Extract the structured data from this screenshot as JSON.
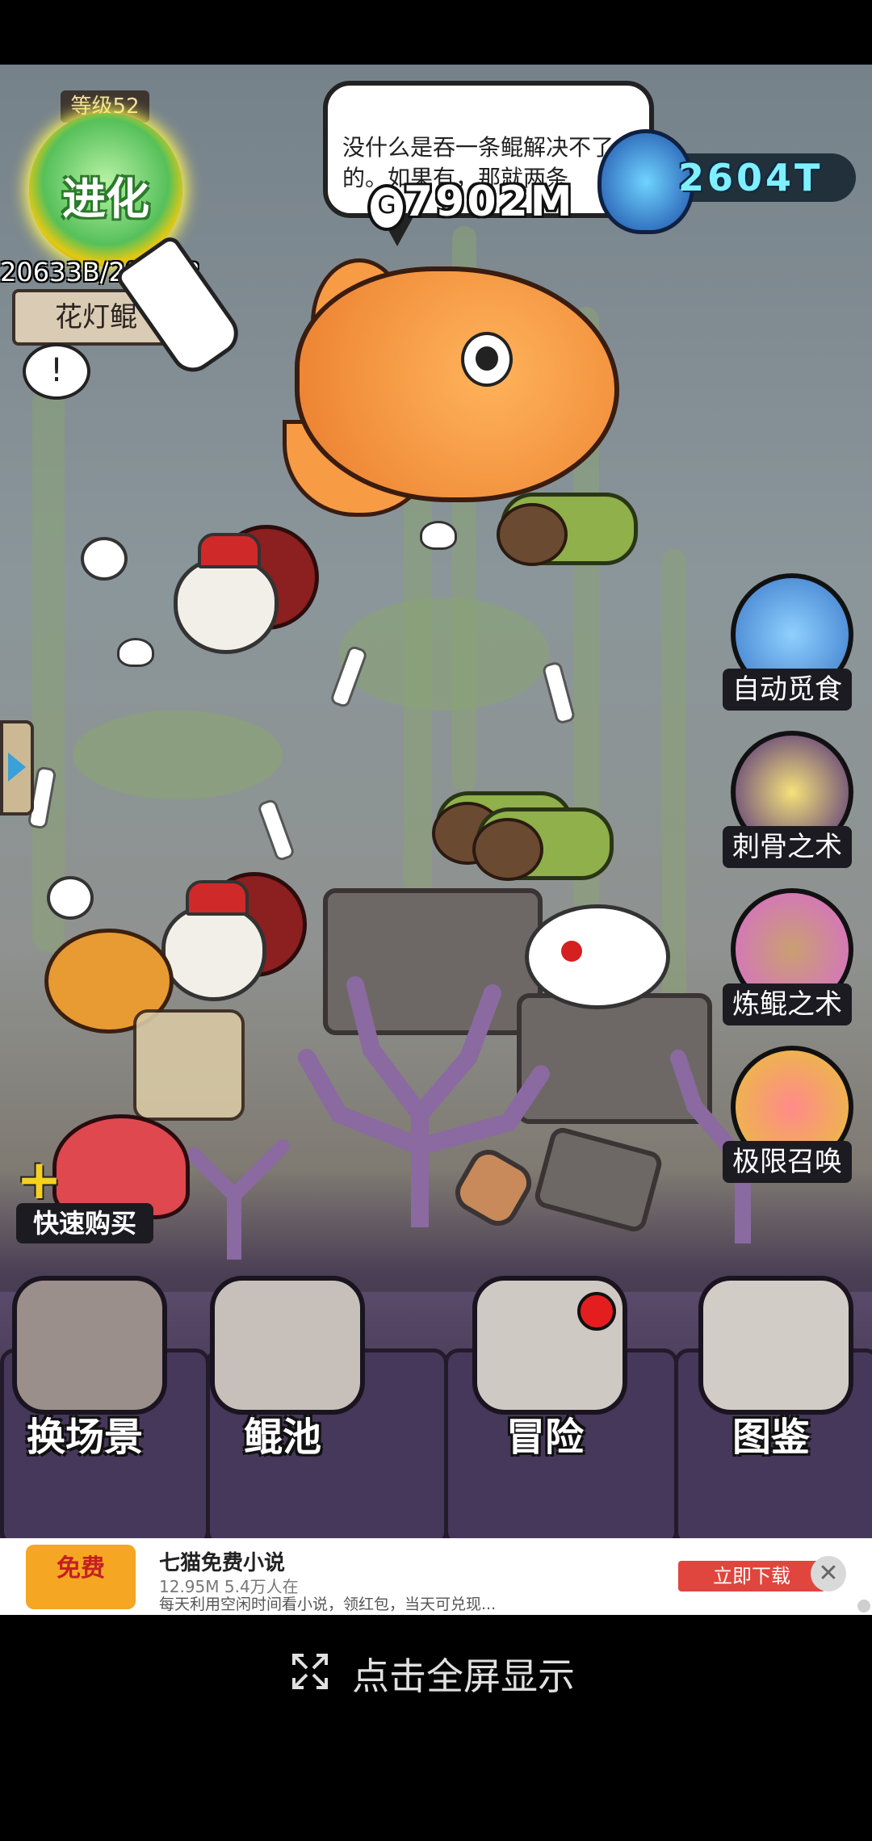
{
  "hud": {
    "level_label": "等级52",
    "evolve_label": "进化",
    "xp_text": "20633B/2063 B",
    "map_name": "花灯鲲",
    "tip_icon": "!",
    "speech": "没什么是吞一条鲲解决不了的。如果有，那就两条",
    "coins": "7902M",
    "coin_icon": "G",
    "gems": "2604T"
  },
  "side_buttons": [
    {
      "label": "自动觅食",
      "color": "#3a78c8"
    },
    {
      "label": "刺骨之术",
      "color": "#4b2a7a"
    },
    {
      "label": "炼鲲之术",
      "color": "#d86ad0"
    },
    {
      "label": "极限召唤",
      "color": "#e8c23a"
    }
  ],
  "quick_buy": {
    "plus": "+",
    "label": "快速购买"
  },
  "nav": [
    {
      "label": "换场景"
    },
    {
      "label": "鲲池"
    },
    {
      "label": "冒险"
    },
    {
      "label": "图鉴"
    }
  ],
  "ad": {
    "logo_text": "免费",
    "title": "七猫免费小说",
    "stats": "12.95M  5.4万人在",
    "description": "每天利用空闲时间看小说，领红包，当天可兑现...",
    "download": "立即下载",
    "close": "✕"
  },
  "fullscreen": {
    "label": "点击全屏显示"
  }
}
